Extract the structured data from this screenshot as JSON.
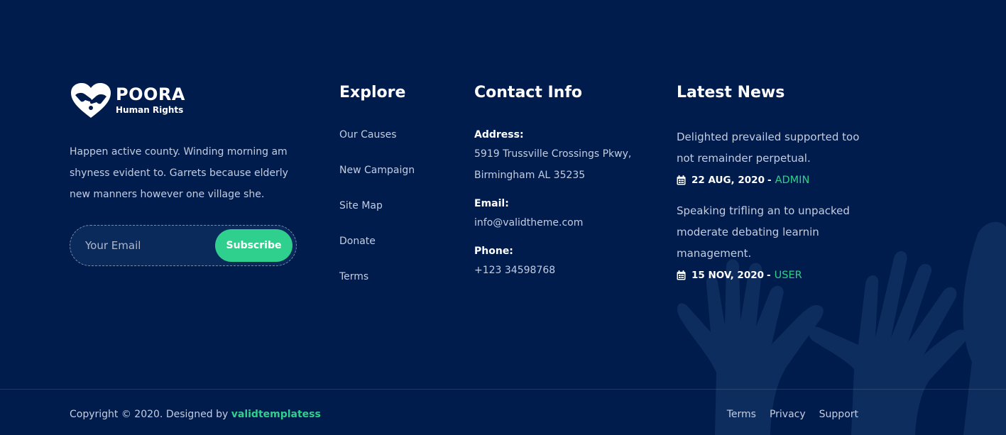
{
  "brand": {
    "name": "POORA",
    "tagline": "Human Rights",
    "logo_icon": "heart-hands-icon",
    "about": "Happen active county. Winding morning am shyness evident to. Garrets because elderly new manners however one village she."
  },
  "subscribe": {
    "placeholder": "Your Email",
    "button_label": "Subscribe"
  },
  "explore": {
    "heading": "Explore",
    "items": [
      {
        "label": "Our Causes"
      },
      {
        "label": "New Campaign"
      },
      {
        "label": "Site Map"
      },
      {
        "label": "Donate"
      },
      {
        "label": "Terms"
      }
    ]
  },
  "contact": {
    "heading": "Contact Info",
    "address_label": "Address:",
    "address_line1": "5919 Trussville Crossings Pkwy,",
    "address_line2": "Birmingham AL 35235",
    "email_label": "Email:",
    "email_value": "info@validtheme.com",
    "phone_label": "Phone:",
    "phone_value": "+123 34598768"
  },
  "news": {
    "heading": "Latest News",
    "items": [
      {
        "title": "Delighted prevailed supported too not remainder perpetual.",
        "date": "22 AUG, 2020",
        "separator": "-",
        "author": "ADMIN",
        "icon": "calendar-icon"
      },
      {
        "title": "Speaking trifling an to unpacked moderate debating learnin management.",
        "date": "15 NOV, 2020",
        "separator": "-",
        "author": "USER",
        "icon": "calendar-icon"
      }
    ]
  },
  "footer": {
    "copyright_prefix": "Copyright © 2020. Designed by",
    "designer": "validtemplatess",
    "links": [
      {
        "label": "Terms"
      },
      {
        "label": "Privacy"
      },
      {
        "label": "Support"
      }
    ]
  },
  "colors": {
    "background": "#001c4d",
    "accent": "#2fd08d",
    "text": "#c4cde0",
    "heading": "#ffffff"
  }
}
